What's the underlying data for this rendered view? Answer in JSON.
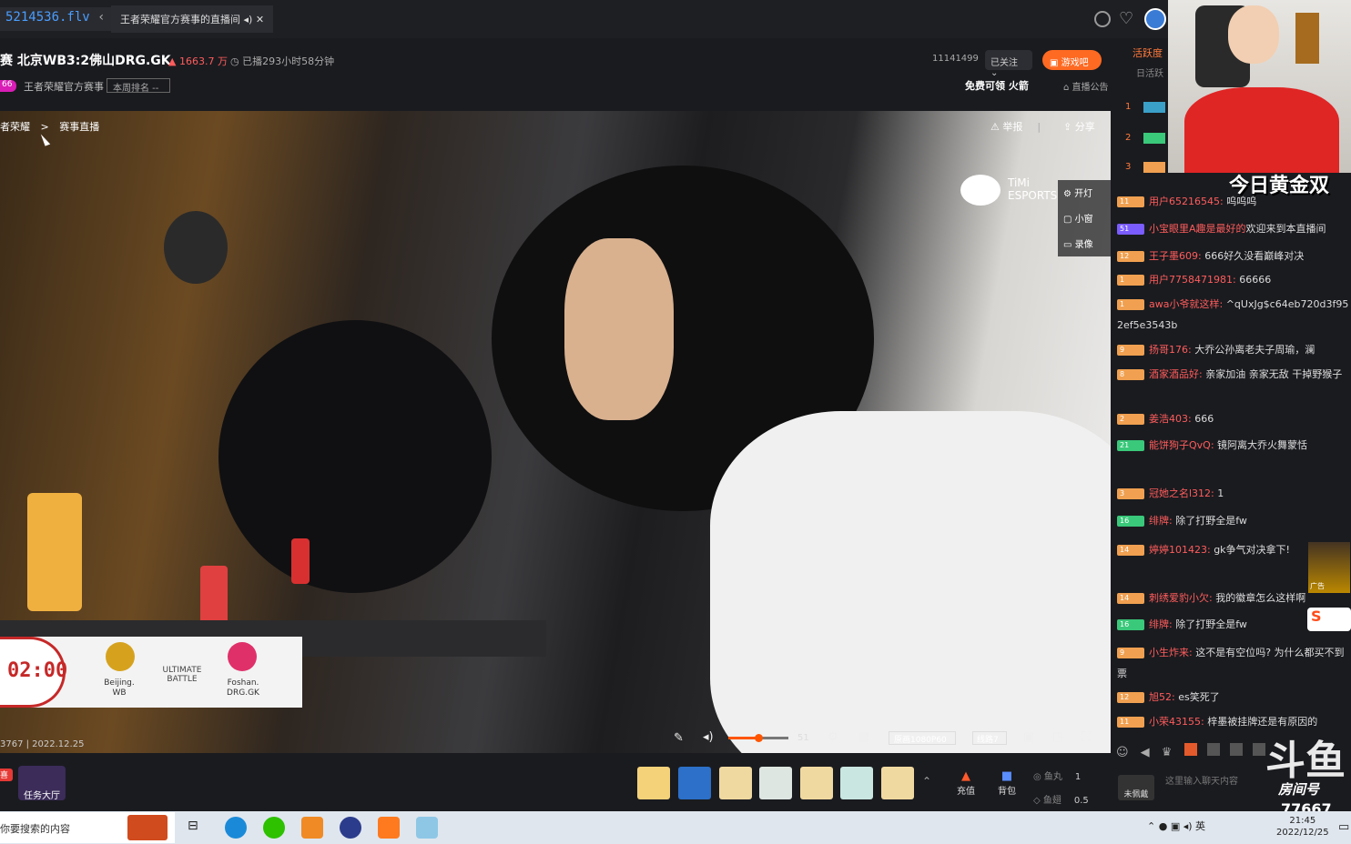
{
  "browser": {
    "url_fragment": "5214536.flv",
    "tab_label": "王者荣耀官方赛事的直播间"
  },
  "header": {
    "title": "赛 北京WB3:2佛山DRG.GK",
    "heat": "1663.7 万",
    "uptime": "已播293小时58分钟",
    "level_badge": "66",
    "category": "王者荣耀官方赛事",
    "rank_button": "本周排名 --",
    "follower_count": "11141499",
    "follow_button": "已关注",
    "game_button": "游戏吧",
    "free_rocket": "免费可领  火箭",
    "notice": "直播公告"
  },
  "video": {
    "breadcrumb_a": "者荣耀",
    "breadcrumb_sep": ">",
    "breadcrumb_b": "赛事直播",
    "report": "举报",
    "share": "分享",
    "timi": "TiMi ESPORTS",
    "tools": [
      "开灯",
      "小窗",
      "录像"
    ],
    "timer": "02:00",
    "team_left": "Beijing.\nWB",
    "ultimate": "ULTIMATE\nBATTLE",
    "team_right": "Foshan.\nDRG.GK",
    "room_date": "3767 | 2022.12.25",
    "volume": "51",
    "quality": "原画1080P60",
    "line": "线路7"
  },
  "giftbar": {
    "task": "任务大厅",
    "badge": "喜",
    "recharge": "充值",
    "bag": "背包",
    "fish_ball_label": "鱼丸",
    "fish_ball_value": "1",
    "fish_wing_label": "鱼翅",
    "fish_wing_value": "0.5"
  },
  "rightpanel": {
    "rank_title": "活跃度",
    "rank_sub": "日活跃",
    "ranks": [
      "1",
      "2",
      "3"
    ],
    "gold_banner": "今日黄金双",
    "messages": [
      {
        "badge": "11",
        "user": "用户65216545:",
        "text": "呜呜呜"
      },
      {
        "badge": "51",
        "user": "小宝眼里A趣是最好的",
        "text": "欢迎来到本直播间"
      },
      {
        "badge": "12",
        "user": "王子墨609:",
        "text": "666好久没看巅峰对决"
      },
      {
        "badge": "1",
        "user": "用户7758471981:",
        "text": "66666"
      },
      {
        "badge": "1",
        "user": "awa小爷就这样:",
        "text": "^qUxJg$c64eb720d3f952ef5e3543b"
      },
      {
        "badge": "9",
        "user": "扬哥176:",
        "text": "大乔公孙离老夫子周瑜，澜"
      },
      {
        "badge": "8",
        "user": "酒家酒品好:",
        "text": "亲家加油 亲家无敌 干掉野猴子"
      },
      {
        "badge": "2",
        "user": "姜浩403:",
        "text": "666"
      },
      {
        "badge": "21",
        "user": "能饼狗子QvQ:",
        "text": "镜阿离大乔火舞蒙恬"
      },
      {
        "badge": "3",
        "user": "冠她之名l312:",
        "text": "1"
      },
      {
        "badge": "16",
        "user": "绯牌:",
        "text": "除了打野全是fw"
      },
      {
        "badge": "14",
        "user": "婷婷101423:",
        "text": "gk争气对决拿下!"
      },
      {
        "badge": "14",
        "user": "刺绣爱豹小欠:",
        "text": "我的徽章怎么这样啊"
      },
      {
        "badge": "16",
        "user": "绯牌:",
        "text": "除了打野全是fw"
      },
      {
        "badge": "9",
        "user": "小生炸来:",
        "text": "这不是有空位吗? 为什么都买不到票"
      },
      {
        "badge": "12",
        "user": "旭52:",
        "text": "es笑死了"
      },
      {
        "badge": "11",
        "user": "小荣43155:",
        "text": "梓墨被挂牌还是有原因的"
      }
    ],
    "chat_placeholder": "这里输入聊天内容",
    "unlogged": "未佩戴",
    "room_label": "房间号",
    "room_number": "77667",
    "ad_label": "广告"
  },
  "taskbar": {
    "search": "你要搜索的内容",
    "ime": "英",
    "time": "21:45",
    "date": "2022/12/25"
  }
}
